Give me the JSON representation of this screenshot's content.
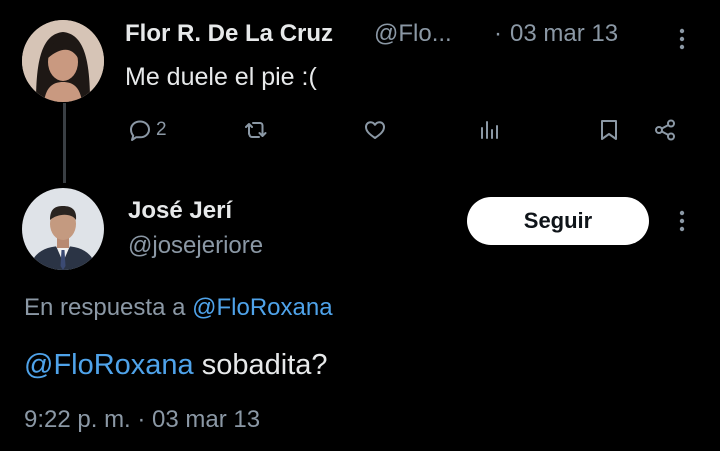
{
  "original_tweet": {
    "display_name": "Flor R. De La Cruz",
    "handle": "@Flo...",
    "separator": "·",
    "date": "03 mar 13",
    "text": "Me duele el pie :(",
    "reply_count": "2"
  },
  "reply_tweet": {
    "display_name": "José Jerí",
    "handle": "@josejeriore",
    "follow_label": "Seguir",
    "reply_context_prefix": "En respuesta a",
    "reply_context_mention": "@FloRoxana",
    "mention": "@FloRoxana",
    "text": " sobadita?",
    "timestamp": "9:22 p. m. · 03 mar 13"
  },
  "colors": {
    "background": "#000000",
    "text": "#e7e9ea",
    "muted": "#8b98a5",
    "link": "#4fa3ea",
    "follow_button": "#ffffff"
  },
  "icons": [
    "reply-icon",
    "retweet-icon",
    "like-icon",
    "views-icon",
    "bookmark-icon",
    "share-icon",
    "more-icon"
  ]
}
